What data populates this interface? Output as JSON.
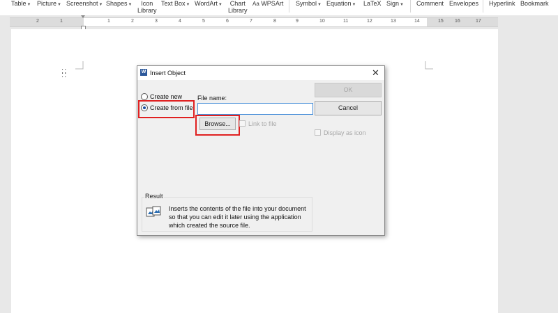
{
  "ribbon": {
    "items": [
      {
        "label": "Table",
        "has_dropdown": true
      },
      {
        "label": "Picture",
        "has_dropdown": true
      },
      {
        "label": "Screenshot",
        "has_dropdown": true
      },
      {
        "label": "Shapes",
        "has_dropdown": true
      },
      {
        "label": "Icon",
        "label2": "Library"
      },
      {
        "label": "Text Box",
        "has_dropdown": true
      },
      {
        "label": "WordArt",
        "has_dropdown": true
      },
      {
        "label": "Chart",
        "label2": "Library"
      },
      {
        "label": "WPSArt"
      },
      {
        "label": "Symbol",
        "has_dropdown": true
      },
      {
        "label": "Equation",
        "has_dropdown": true
      },
      {
        "label": "LaTeX"
      },
      {
        "label": "Sign",
        "has_dropdown": true
      },
      {
        "label": "Comment"
      },
      {
        "label": "Envelopes"
      },
      {
        "label": "Hyperlink"
      },
      {
        "label": "Bookmark"
      }
    ]
  },
  "ruler": {
    "numbers": [
      "2",
      "1",
      "1",
      "2",
      "3",
      "4",
      "5",
      "6",
      "7",
      "8",
      "9",
      "10",
      "11",
      "12",
      "13",
      "14",
      "15",
      "16",
      "17"
    ]
  },
  "dialog": {
    "title": "Insert Object",
    "app_icon_letter": "W",
    "close_glyph": "✕",
    "create_new_label": "Create new",
    "create_from_file_label": "Create from file",
    "selected_option": "Create from file",
    "file_name_label": "File name:",
    "file_name_value": "",
    "browse_label": "Browse...",
    "link_to_file_label": "Link to file",
    "ok_label": "OK",
    "cancel_label": "Cancel",
    "display_as_icon_label": "Display as icon",
    "result_label": "Result",
    "result_text": "Inserts the contents of the file into your document so that you can edit it later using the application which created the source file."
  },
  "colors": {
    "highlight": "#e02020",
    "focus_border": "#4a90d9",
    "word_icon": "#2b579a"
  }
}
